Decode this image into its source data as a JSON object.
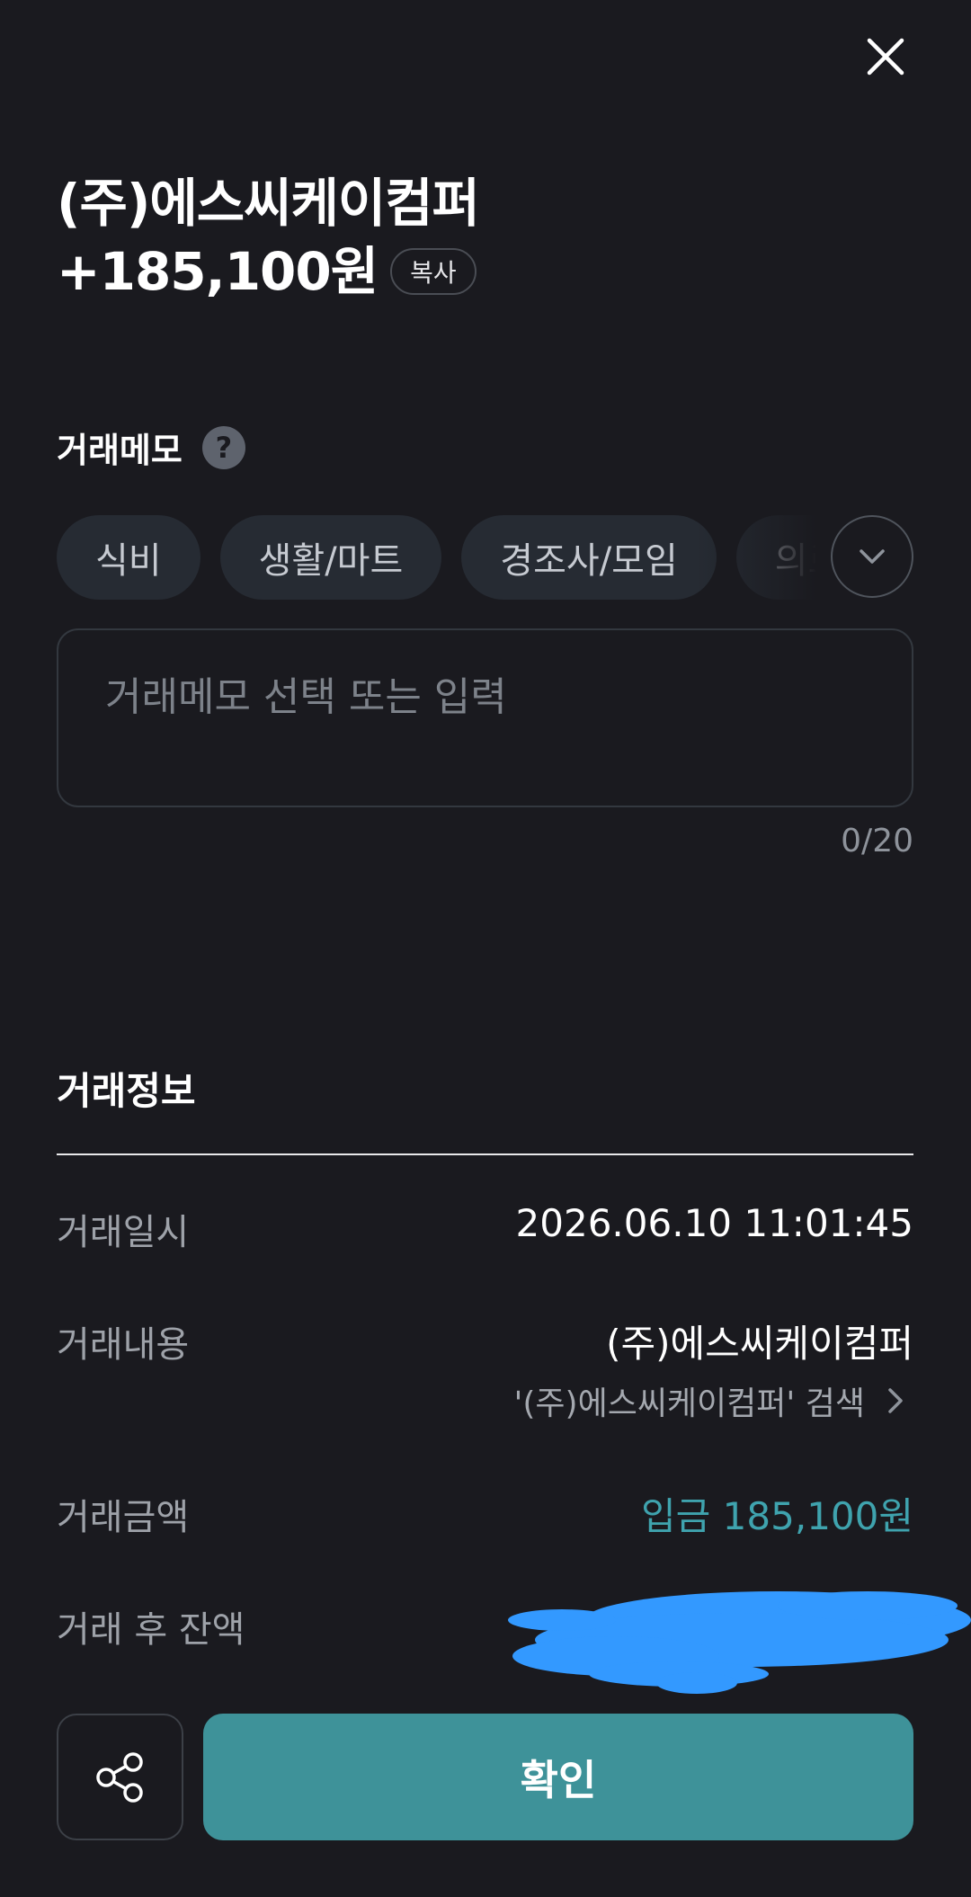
{
  "header": {
    "merchant": "(주)에스씨케이컴퍼",
    "amount": "+185,100원",
    "copy_label": "복사"
  },
  "memo": {
    "label": "거래메모",
    "help_glyph": "?",
    "chips": [
      "식비",
      "생활/마트",
      "경조사/모임",
      "의료"
    ],
    "placeholder": "거래메모 선택 또는 입력",
    "counter": "0/20"
  },
  "info": {
    "title": "거래정보",
    "datetime_label": "거래일시",
    "datetime_value": "2026.06.10 11:01:45",
    "desc_label": "거래내용",
    "desc_value": "(주)에스씨케이컴퍼",
    "search_link": "'(주)에스씨케이컴퍼' 검색",
    "amount_label": "거래금액",
    "amount_value": "입금 185,100원",
    "balance_label": "거래 후 잔액"
  },
  "footer": {
    "confirm_label": "확인"
  },
  "colors": {
    "background": "#1a1a1f",
    "accent": "#3e9299",
    "deposit_text": "#3fa3ae",
    "redaction": "#3399ff"
  },
  "icons": {
    "close": "close-icon",
    "help": "help-icon",
    "expand": "chevron-down-icon",
    "link": "chevron-right-icon",
    "share": "share-icon"
  }
}
